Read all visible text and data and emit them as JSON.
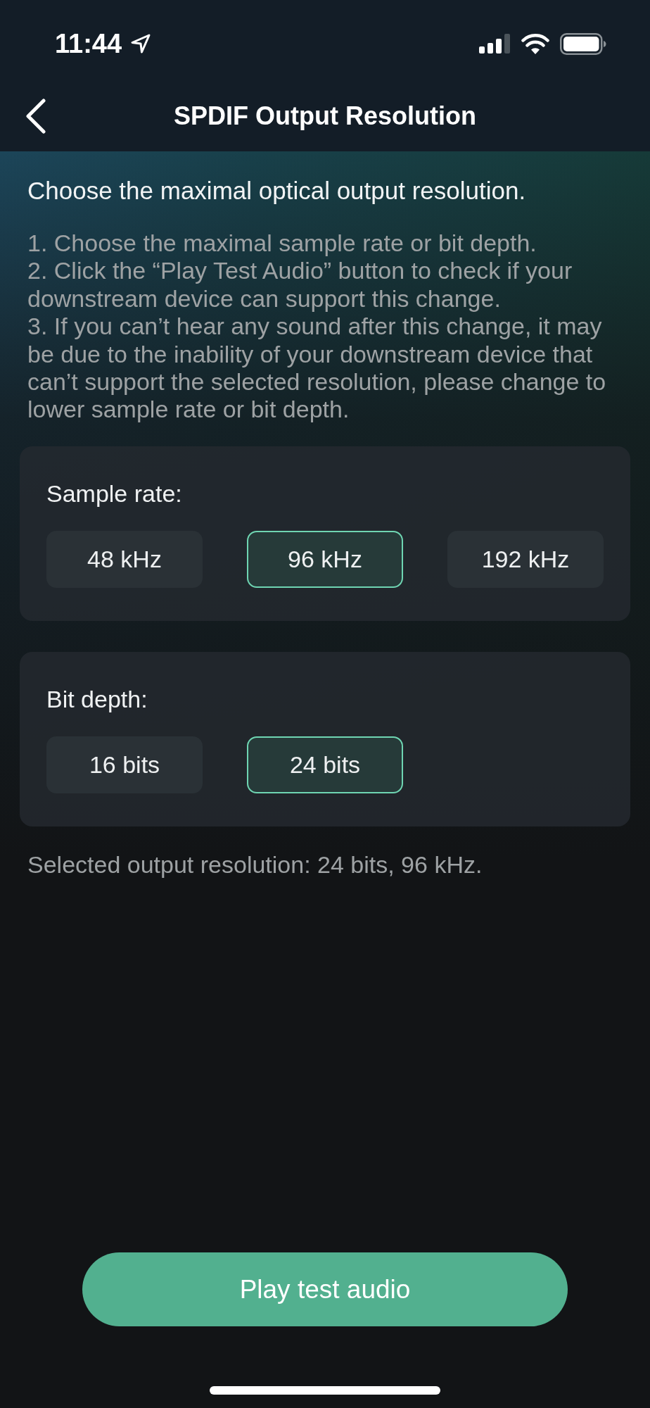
{
  "status_bar": {
    "time": "11:44"
  },
  "header": {
    "title": "SPDIF Output Resolution"
  },
  "intro": "Choose the maximal optical output resolution.",
  "instructions": [
    "1. Choose the maximal sample rate or bit depth.",
    "2. Click the “Play Test Audio” button to check if your downstream device can support this change.",
    "3. If you can’t hear any sound after this change, it may be due to the inability of your downstream device that can’t support the selected resolution, please change to lower sample rate or bit depth."
  ],
  "groups": [
    {
      "label": "Sample rate:",
      "options": [
        {
          "label": "48 kHz",
          "selected": false
        },
        {
          "label": "96 kHz",
          "selected": true
        },
        {
          "label": "192 kHz",
          "selected": false
        }
      ]
    },
    {
      "label": "Bit depth:",
      "options": [
        {
          "label": "16 bits",
          "selected": false
        },
        {
          "label": "24 bits",
          "selected": true
        }
      ]
    }
  ],
  "summary": "Selected output resolution: 24 bits, 96 kHz.",
  "play_button": {
    "label": "Play test audio"
  }
}
